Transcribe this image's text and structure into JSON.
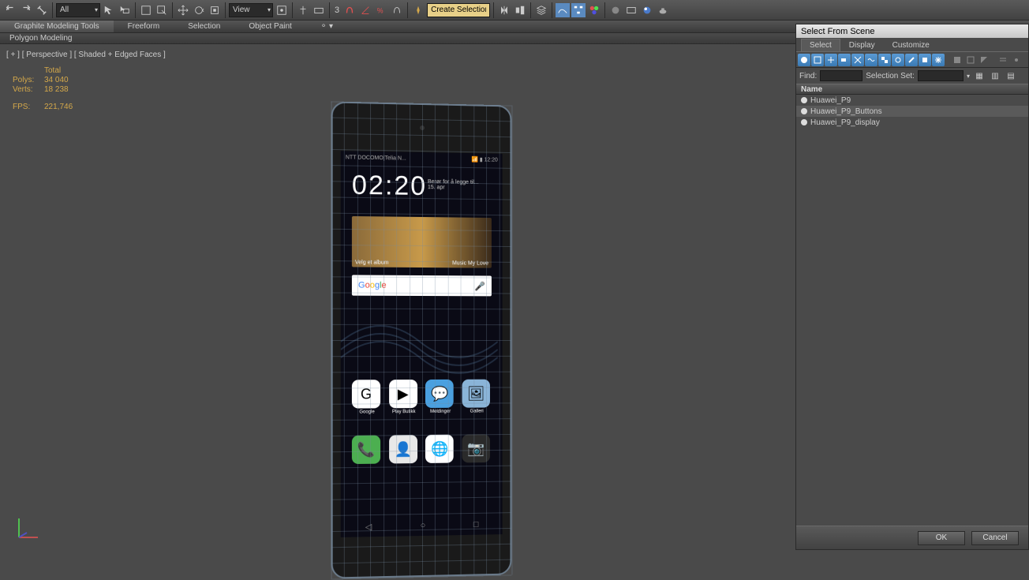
{
  "toolbar": {
    "dropdown_all": "All",
    "dropdown_view": "View",
    "numeric": "3",
    "create_input": "Create Selection Se"
  },
  "ribbon": {
    "tabs": [
      "Graphite Modeling Tools",
      "Freeform",
      "Selection",
      "Object Paint"
    ],
    "sub": "Polygon Modeling"
  },
  "viewport": {
    "label": "[ + ] [ Perspective ] [ Shaded + Edged Faces ]",
    "stats": {
      "total": "Total",
      "polys_lbl": "Polys:",
      "polys_val": "34 040",
      "verts_lbl": "Verts:",
      "verts_val": "18 238",
      "fps_lbl": "FPS:",
      "fps_val": "221,746"
    }
  },
  "phone": {
    "status_left": "NTT DOCOMO|Telia N...",
    "status_right": "📶 ▮ 12:20",
    "clock": "02:20",
    "clock_sub": "Berør for å legge til...\n15. apr",
    "widget_left": "Velg et album",
    "widget_right": "Music My Love",
    "search": "Google",
    "apps_row1": [
      {
        "label": "Google",
        "bg": "#fff",
        "txt": "G"
      },
      {
        "label": "Play Butikk",
        "bg": "#fff",
        "txt": "▶"
      },
      {
        "label": "Meldinger",
        "bg": "#4aa0e0",
        "txt": "💬"
      },
      {
        "label": "Galleri",
        "bg": "#8ab4d8",
        "txt": "🖼"
      }
    ],
    "apps_row2": [
      {
        "label": "",
        "bg": "#4caf50",
        "txt": "📞"
      },
      {
        "label": "",
        "bg": "#e8e8e8",
        "txt": "👤"
      },
      {
        "label": "",
        "bg": "#fff",
        "txt": "🌐"
      },
      {
        "label": "",
        "bg": "#2a2a2a",
        "txt": "📷"
      }
    ],
    "nav": [
      "◁",
      "○",
      "□"
    ]
  },
  "dialog": {
    "title": "Select From Scene",
    "tabs": [
      "Select",
      "Display",
      "Customize"
    ],
    "find_lbl": "Find:",
    "selset_lbl": "Selection Set:",
    "header": "Name",
    "items": [
      {
        "name": "Huawei_P9",
        "sel": false
      },
      {
        "name": "Huawei_P9_Buttons",
        "sel": true
      },
      {
        "name": "Huawei_P9_display",
        "sel": false
      }
    ],
    "ok": "OK",
    "cancel": "Cancel"
  }
}
